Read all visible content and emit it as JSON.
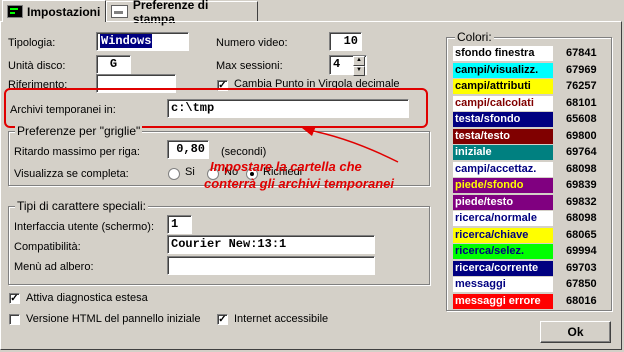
{
  "tabs": [
    {
      "label": "Impostazioni"
    },
    {
      "label": "Preferenze di stampa"
    }
  ],
  "fields": {
    "tipologia": {
      "label": "Tipologia:",
      "value": "Windows"
    },
    "numero_video": {
      "label": "Numero video:",
      "value": "10"
    },
    "unita_disco": {
      "label": "Unità disco:",
      "value": "G"
    },
    "max_sessioni": {
      "label": "Max sessioni:",
      "value": "4"
    },
    "riferimento": {
      "label": "Riferimento:",
      "value": ""
    },
    "cambia_punto": {
      "label": "Cambia Punto in Virgola decimale",
      "checked": true
    },
    "archivi": {
      "label": "Archivi temporanei in:",
      "value": "c:\\tmp"
    }
  },
  "griglie": {
    "title": "Preferenze per \"griglie\"",
    "ritardo_label": "Ritardo massimo per riga:",
    "ritardo_value": "0,80",
    "ritardo_unit": "(secondi)",
    "visualizza_label": "Visualizza se completa:",
    "opt_si": "Si",
    "opt_no": "No",
    "opt_richiedi": "Richiedi"
  },
  "annotation": {
    "line1": "Impostare la cartella che",
    "line2": "conterrà gli archivi temporanei",
    "color": "#e00000"
  },
  "carattere": {
    "title": "Tipi di carattere speciali:",
    "interfaccia_label": "Interfaccia utente (schermo):",
    "interfaccia_value": "1",
    "compat_label": "Compatibilità:",
    "compat_value": "Courier New:13:1",
    "menu_label": "Menù ad albero:",
    "menu_value": ""
  },
  "options": {
    "diagnostica": {
      "label": "Attiva diagnostica estesa",
      "checked": true
    },
    "html": {
      "label": "Versione HTML del pannello iniziale",
      "checked": false
    },
    "internet": {
      "label": "Internet accessibile",
      "checked": true
    }
  },
  "colori": {
    "title": "Colori:",
    "items": [
      {
        "name": "sfondo finestra",
        "value": "67841",
        "bg": "#ffffff",
        "fg": "#000000"
      },
      {
        "name": "campi/visualizz.",
        "value": "67969",
        "bg": "#00ffff",
        "fg": "#000000"
      },
      {
        "name": "campi/attributi",
        "value": "76257",
        "bg": "#ffff00",
        "fg": "#000000"
      },
      {
        "name": "campi/calcolati",
        "value": "68101",
        "bg": "#ffffff",
        "fg": "#800000"
      },
      {
        "name": "testa/sfondo",
        "value": "65608",
        "bg": "#000080",
        "fg": "#ffffff"
      },
      {
        "name": "testa/testo",
        "value": "69800",
        "bg": "#800000",
        "fg": "#ffffff"
      },
      {
        "name": "iniziale",
        "value": "69764",
        "bg": "#008080",
        "fg": "#ffffff"
      },
      {
        "name": "campi/accettaz.",
        "value": "68098",
        "bg": "#ffffff",
        "fg": "#000080"
      },
      {
        "name": "piede/sfondo",
        "value": "69839",
        "bg": "#800080",
        "fg": "#ffff00"
      },
      {
        "name": "piede/testo",
        "value": "69832",
        "bg": "#800080",
        "fg": "#ffffff"
      },
      {
        "name": "ricerca/normale",
        "value": "68098",
        "bg": "#ffffff",
        "fg": "#000080"
      },
      {
        "name": "ricerca/chiave",
        "value": "68065",
        "bg": "#ffff00",
        "fg": "#000080"
      },
      {
        "name": "ricerca/selez.",
        "value": "69994",
        "bg": "#00ff00",
        "fg": "#000080"
      },
      {
        "name": "ricerca/corrente",
        "value": "69703",
        "bg": "#000080",
        "fg": "#ffffff"
      },
      {
        "name": "messaggi",
        "value": "67850",
        "bg": "#ffffff",
        "fg": "#000080"
      },
      {
        "name": "messaggi errore",
        "value": "68016",
        "bg": "#ff0000",
        "fg": "#ffffff"
      }
    ]
  },
  "buttons": {
    "ok": "Ok"
  }
}
